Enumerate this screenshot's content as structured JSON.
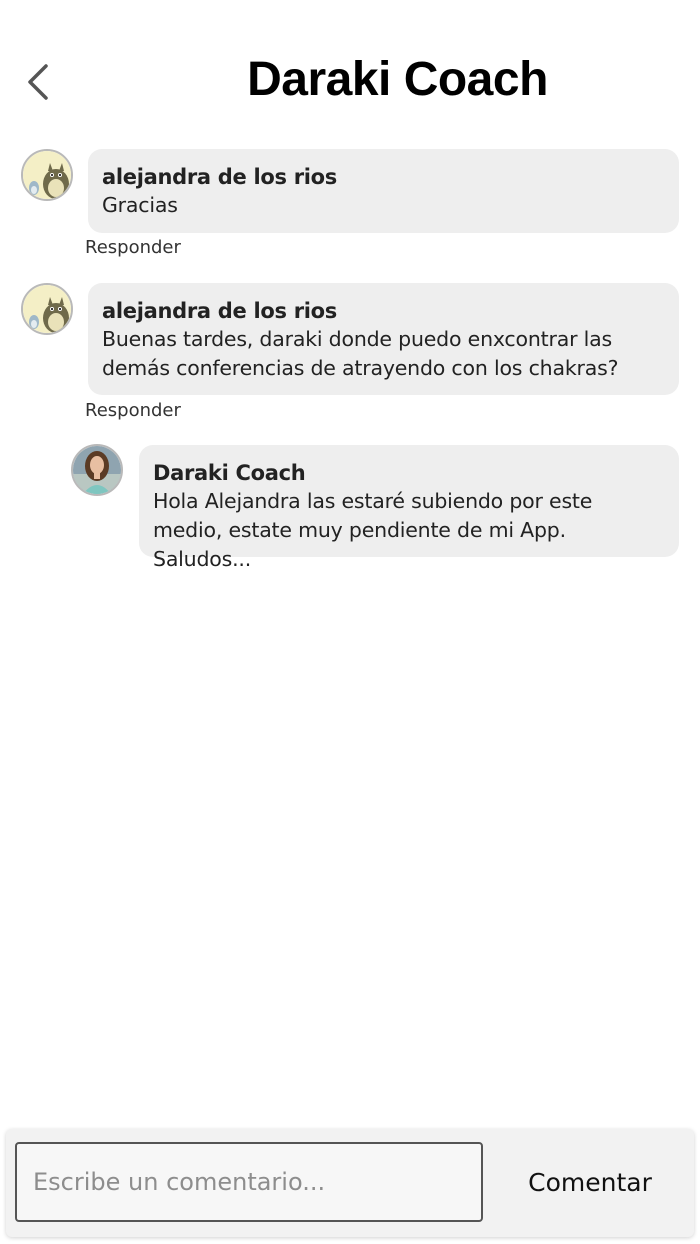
{
  "header": {
    "title": "Daraki Coach",
    "back_icon": "chevron-left-icon"
  },
  "comments": [
    {
      "author": "alejandra de los rios",
      "text": "Gracias",
      "reply_label": "Responder",
      "avatar": "totoro-avatar"
    },
    {
      "author": "alejandra de los rios",
      "text": "Buenas tardes, daraki donde puedo enxcontrar las\ndemás conferencias de atrayendo con los chakras?",
      "reply_label": "Responder",
      "avatar": "totoro-avatar",
      "replies": [
        {
          "author": "Daraki Coach",
          "text": "Hola Alejandra las estaré subiendo por este\nmedio, estate muy pendiente de mi App. Saludos...",
          "avatar": "coach-photo-avatar"
        }
      ]
    }
  ],
  "composer": {
    "placeholder": "Escribe un comentario...",
    "value": "",
    "submit_label": "Comentar"
  },
  "colors": {
    "bubble": "#eeeeee",
    "background": "#ffffff",
    "footer": "#f2f2f2"
  }
}
